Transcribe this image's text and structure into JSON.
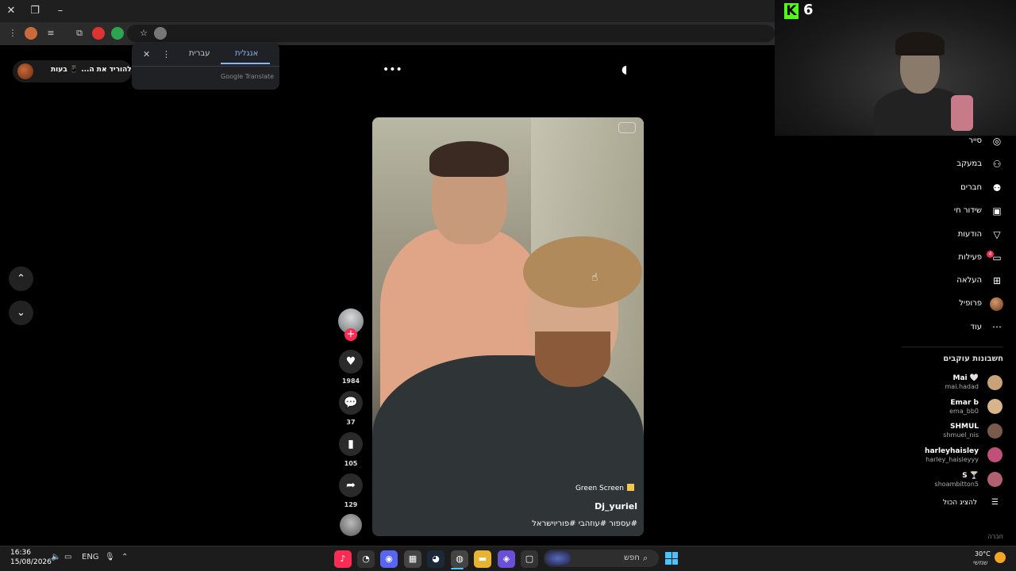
{
  "translate_popup": {
    "tabs": [
      "אנגלית",
      "עברית"
    ],
    "active_tab": 0,
    "brand": "Google Translate"
  },
  "download_pill": {
    "label": "להוריד את ה...",
    "partial_label": "בעות"
  },
  "video": {
    "effect_label": "Green Screen",
    "username": "Dj_yuriel",
    "caption": "#עספור #עוזהבי #פוריוישראל"
  },
  "rail": {
    "likes": "1984",
    "comments": "37",
    "saves": "105",
    "shares": "129"
  },
  "webcam": {
    "viewer_count": "6",
    "platform_letter": "K"
  },
  "sidebar": {
    "items": [
      {
        "label": "סייר",
        "icon": "compass-icon"
      },
      {
        "label": "במעקב",
        "icon": "user-plus-icon"
      },
      {
        "label": "חברים",
        "icon": "friends-icon"
      },
      {
        "label": "שידור חי",
        "icon": "live-tv-icon"
      },
      {
        "label": "הודעות",
        "icon": "send-icon"
      },
      {
        "label": "פעילות",
        "icon": "activity-icon"
      },
      {
        "label": "העלאה",
        "icon": "upload-icon"
      },
      {
        "label": "פרופיל",
        "icon": "profile-avatar"
      },
      {
        "label": "עוד",
        "icon": "more-icon"
      }
    ],
    "activity_badge": "4",
    "following_title": "חשבונות עוקבים",
    "accounts": [
      {
        "name": "Mai 🤍",
        "handle": "mai.hadad",
        "color": "#c9a27a"
      },
      {
        "name": "Emar b",
        "handle": "ema_bb0",
        "color": "#d7b48a"
      },
      {
        "name": "SHMUL",
        "handle": "shmuel_nis",
        "color": "#7a5a4a"
      },
      {
        "name": "harleyhaisley",
        "handle": "harley_haisleyyy",
        "color": "#c0507a"
      },
      {
        "name": "S 🍸",
        "handle": "shoambitton5",
        "color": "#b06070"
      }
    ],
    "show_all": "להציג הכול",
    "company": "חברה"
  },
  "taskbar": {
    "time": "16:36",
    "date": "15/08/2026",
    "language": "ENG",
    "search_placeholder": "חפש",
    "weather_temp": "30°C",
    "weather_cond": "שמשי"
  }
}
